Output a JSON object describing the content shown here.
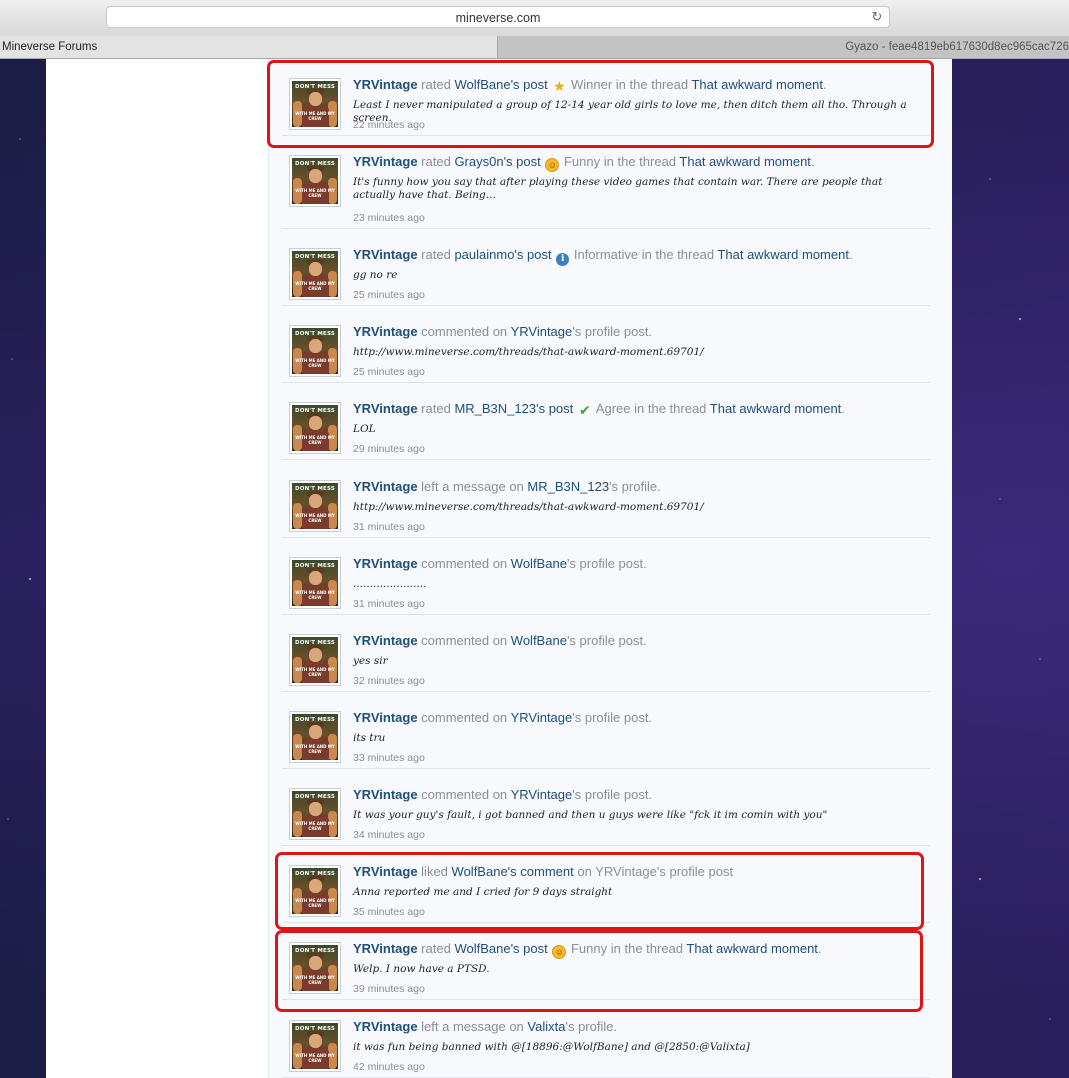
{
  "browser": {
    "url": "mineverse.com",
    "tabs": [
      {
        "label": "Mineverse Forums",
        "active": true
      },
      {
        "label": "Gyazo - feae4819eb617630d8ec965cac726",
        "active": false
      }
    ]
  },
  "avatar": {
    "top_text": "DON'T MESS",
    "bottom_text": "WITH ME AND MY CREW"
  },
  "feed": [
    {
      "actor": "YRVintage",
      "verb": "rated",
      "target": "WolfBane's post",
      "icon": "star-icon",
      "rating": "Winner",
      "context": "in the thread",
      "link": "That awkward moment",
      "end": ".",
      "snippet": "Least I never manipulated a group of 12-14 year old girls to love me, then ditch them all tho. Through a screen.",
      "time": "22 minutes ago",
      "highlighted": true
    },
    {
      "actor": "YRVintage",
      "verb": "rated",
      "target": "Grays0n's post",
      "icon": "smile-icon",
      "rating": "Funny",
      "context": "in the thread",
      "link": "That awkward moment",
      "end": ".",
      "snippet": "It's funny how you say that after playing these video games that contain war. There are people that actually have that. Being...",
      "time": "23 minutes ago",
      "highlighted": false
    },
    {
      "actor": "YRVintage",
      "verb": "rated",
      "target": "paulainmo's post",
      "icon": "info-icon",
      "rating": "Informative",
      "context": "in the thread",
      "link": "That awkward moment",
      "end": ".",
      "snippet": "gg no re",
      "time": "25 minutes ago",
      "highlighted": false
    },
    {
      "actor": "YRVintage",
      "verb": "commented on",
      "target": "YRVintage",
      "icon": "",
      "rating": "",
      "context": "'s profile post.",
      "link": "",
      "end": "",
      "snippet": "http://www.mineverse.com/threads/that-awkward-moment.69701/",
      "time": "25 minutes ago",
      "highlighted": false
    },
    {
      "actor": "YRVintage",
      "verb": "rated",
      "target": "MR_B3N_123's post",
      "icon": "check-icon",
      "rating": "Agree",
      "context": "in the thread",
      "link": "That awkward moment",
      "end": ".",
      "snippet": "LOL",
      "time": "29 minutes ago",
      "highlighted": false
    },
    {
      "actor": "YRVintage",
      "verb": "left a message on",
      "target": "MR_B3N_123",
      "icon": "",
      "rating": "",
      "context": "'s profile.",
      "link": "",
      "end": "",
      "snippet": "http://www.mineverse.com/threads/that-awkward-moment.69701/",
      "time": "31 minutes ago",
      "highlighted": false
    },
    {
      "actor": "YRVintage",
      "verb": "commented on",
      "target": "WolfBane",
      "icon": "",
      "rating": "",
      "context": "'s profile post.",
      "link": "",
      "end": "",
      "snippet": "......................",
      "time": "31 minutes ago",
      "highlighted": false
    },
    {
      "actor": "YRVintage",
      "verb": "commented on",
      "target": "WolfBane",
      "icon": "",
      "rating": "",
      "context": "'s profile post.",
      "link": "",
      "end": "",
      "snippet": "yes sir",
      "time": "32 minutes ago",
      "highlighted": false
    },
    {
      "actor": "YRVintage",
      "verb": "commented on",
      "target": "YRVintage",
      "icon": "",
      "rating": "",
      "context": "'s profile post.",
      "link": "",
      "end": "",
      "snippet": "its tru",
      "time": "33 minutes ago",
      "highlighted": false
    },
    {
      "actor": "YRVintage",
      "verb": "commented on",
      "target": "YRVintage",
      "icon": "",
      "rating": "",
      "context": "'s profile post.",
      "link": "",
      "end": "",
      "snippet": "It was your guy's fault, i got banned and then u guys were like \"fck it im comin with you\"",
      "time": "34 minutes ago",
      "highlighted": false
    },
    {
      "actor": "YRVintage",
      "verb": "liked",
      "target": "WolfBane's comment",
      "icon": "",
      "rating": "",
      "context": "on YRVintage's profile post",
      "link": "",
      "end": "",
      "snippet": "Anna reported me and I cried for 9 days straight",
      "time": "35 minutes ago",
      "highlighted": true
    },
    {
      "actor": "YRVintage",
      "verb": "rated",
      "target": "WolfBane's post",
      "icon": "smile-icon",
      "rating": "Funny",
      "context": "in the thread",
      "link": "That awkward moment",
      "end": ".",
      "snippet": "Welp. I now have a PTSD.",
      "time": "39 minutes ago",
      "highlighted": true
    },
    {
      "actor": "YRVintage",
      "verb": "left a message on",
      "target": "Valixta",
      "icon": "",
      "rating": "",
      "context": "'s profile.",
      "link": "",
      "end": "",
      "snippet": "it was fun being banned with @[18896:@WolfBane] and @[2850:@Valixta]",
      "time": "42 minutes ago",
      "highlighted": false
    }
  ],
  "colors": {
    "link": "#1f4f7c",
    "muted": "#8a8f96",
    "highlight": "#e01414"
  }
}
